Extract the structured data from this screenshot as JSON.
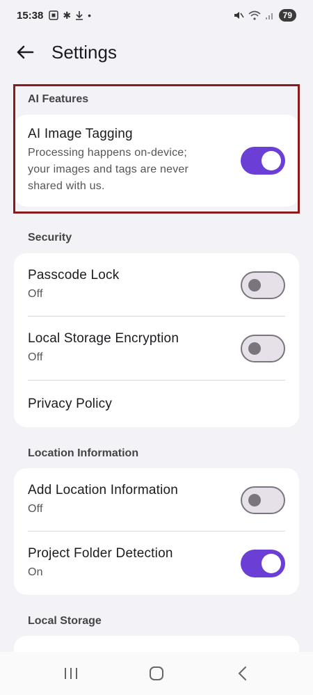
{
  "status_bar": {
    "time": "15:38",
    "left_icons": [
      "screenshot-icon",
      "asterisk-icon",
      "download-icon",
      "dot-icon"
    ],
    "battery": "79"
  },
  "header": {
    "title": "Settings"
  },
  "sections": {
    "ai": {
      "label": "AI Features",
      "items": [
        {
          "title": "AI Image Tagging",
          "subtitle_line1": "Processing happens on-device;",
          "subtitle_line2": "your images and tags are never",
          "subtitle_line3": "shared with us.",
          "toggle": true
        }
      ]
    },
    "security": {
      "label": "Security",
      "items": [
        {
          "title": "Passcode Lock",
          "subtitle": "Off",
          "toggle": false
        },
        {
          "title": "Local Storage Encryption",
          "subtitle": "Off",
          "toggle": false
        },
        {
          "title": "Privacy Policy"
        }
      ]
    },
    "location": {
      "label": "Location Information",
      "items": [
        {
          "title": "Add Location Information",
          "subtitle": "Off",
          "toggle": false
        },
        {
          "title": "Project Folder Detection",
          "subtitle": "On",
          "toggle": true
        }
      ]
    },
    "storage": {
      "label": "Local Storage"
    }
  },
  "colors": {
    "accent": "#6b3fd6",
    "highlight": "#8b1a1a",
    "background": "#f2f2f7"
  }
}
